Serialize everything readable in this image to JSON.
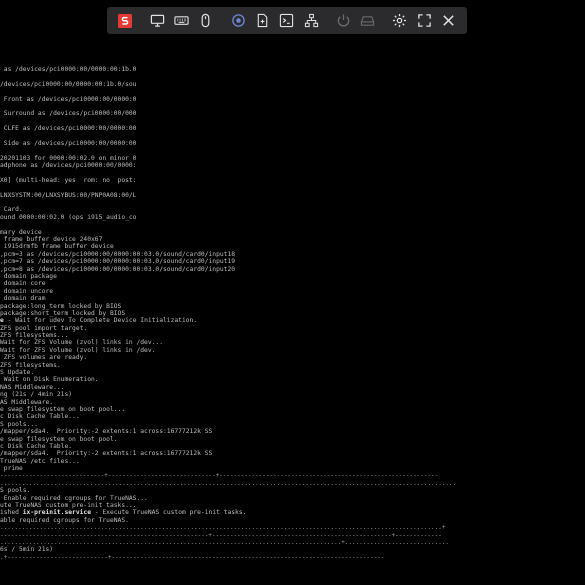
{
  "toolbar": {
    "buttons": [
      {
        "name": "logo-icon",
        "label": "S",
        "color": "#e53935"
      },
      {
        "name": "monitor-icon"
      },
      {
        "name": "keyboard-icon"
      },
      {
        "name": "mouse-icon"
      },
      {
        "name": "record-icon"
      },
      {
        "name": "file-icon"
      },
      {
        "name": "terminal-icon"
      },
      {
        "name": "network-icon"
      },
      {
        "name": "power-icon"
      },
      {
        "name": "drive-icon"
      },
      {
        "name": "gear-icon"
      },
      {
        "name": "fullscreen-icon"
      },
      {
        "name": "close-icon"
      }
    ]
  },
  "console": {
    "lines": [
      {
        "text": " as /devices/pci0000:00/0000:00:1b.0"
      },
      {
        "text": ""
      },
      {
        "text": "/devices/pci0000:00/0000:00:1b.0/sou"
      },
      {
        "text": ""
      },
      {
        "text": " Front as /devices/pci0000:00/0000:0"
      },
      {
        "text": ""
      },
      {
        "text": " Surround as /devices/pci0000:00/000"
      },
      {
        "text": ""
      },
      {
        "text": " CLFE as /devices/pci0000:00/0000:00"
      },
      {
        "text": ""
      },
      {
        "text": " Side as /devices/pci0000:00/0000:00"
      },
      {
        "text": ""
      },
      {
        "text": "20201103 for 0000:00:02.0 on minor 0"
      },
      {
        "text": "adphone as /devices/pci0000:00/0000:"
      },
      {
        "text": ""
      },
      {
        "text": "X0] (multi-head: yes  rom: no  post:"
      },
      {
        "text": ""
      },
      {
        "text": "LNXSYSTM:00/LNXSYBUS:00/PNP0A08:00/L"
      },
      {
        "text": ""
      },
      {
        "text": " Card."
      },
      {
        "text": "ound 0000:00:02.0 (ops i915_audio_co"
      },
      {
        "text": ""
      },
      {
        "text": "mary device"
      },
      {
        "text": " frame buffer device 240x67"
      },
      {
        "text": " i915drmfb frame buffer device"
      },
      {
        "text": ",pcm=3 as /devices/pci0000:00/0000:00:03.0/sound/card0/input18"
      },
      {
        "text": ",pcm=7 as /devices/pci0000:00/0000:00:03.0/sound/card0/input19"
      },
      {
        "text": ",pcm=8 as /devices/pci0000:00/0000:00:03.0/sound/card0/input20"
      },
      {
        "text": " domain package"
      },
      {
        "text": " domain core"
      },
      {
        "text": " domain uncore"
      },
      {
        "text": " domain dram"
      },
      {
        "text": "package:long_term locked by BIOS"
      },
      {
        "text": "package:short_term locked by BIOS"
      },
      {
        "text": "e - Wait for udev To Complete Device Initialization.",
        "boldPrefix": "e"
      },
      {
        "text": "ZFS pool import target."
      },
      {
        "text": "ZFS filesystems..."
      },
      {
        "text": "Wait for ZFS Volume (zvol) links in /dev..."
      },
      {
        "text": "Wait for ZFS Volume (zvol) links in /dev."
      },
      {
        "text": " ZFS volumes are ready."
      },
      {
        "text": "ZFS filesystems."
      },
      {
        "text": "S Update."
      },
      {
        "text": " Wait on Disk Enumeration."
      },
      {
        "text": "NAS Middleware..."
      },
      {
        "text": "ng (21s / 4min 21s)"
      },
      {
        "text": "AS Middleware."
      },
      {
        "text": "e swap filesystem on boot pool..."
      },
      {
        "text": "c Disk Cache Table..."
      },
      {
        "text": "S pools..."
      },
      {
        "text": "/mapper/sda4.  Priority:-2 extents:1 across:16777212k SS"
      },
      {
        "text": "e swap filesystem on boot pool."
      },
      {
        "text": "c Disk Cache Table."
      },
      {
        "text": "/mapper/sda4.  Priority:-2 extents:1 across:16777212k SS"
      },
      {
        "text": "TrueNAS /etc files..."
      },
      {
        "text": " prime"
      },
      {
        "text": "-----------------------------+------------------------------+-------------------------------------------------------------",
        "dash": true
      },
      {
        "text": "...............................................................................................................................",
        "dash": true
      },
      {
        "text": "S pools."
      },
      {
        "text": " Enable required cgroups for TrueNAS..."
      },
      {
        "text": "ute TrueNAS custom pre-init tasks..."
      },
      {
        "text": "ished ix-preinit.service - Execute TrueNAS custom pre-init tasks.",
        "boldWord": "ix-preinit.service"
      },
      {
        "text": "able required cgroups for TrueNAS."
      },
      {
        "text": "...........................................................................................................................+",
        "dash": true
      },
      {
        "text": "----------------------------------------------------------+--------------------------------------------------+-------------",
        "dash": true
      },
      {
        "text": "...............................................................................................+.............................",
        "dash": true
      },
      {
        "text": "6s / 5min 21s)"
      },
      {
        "text": ".+----------------------------+----------------------------------------------------------------------------",
        "dash": true
      }
    ]
  }
}
